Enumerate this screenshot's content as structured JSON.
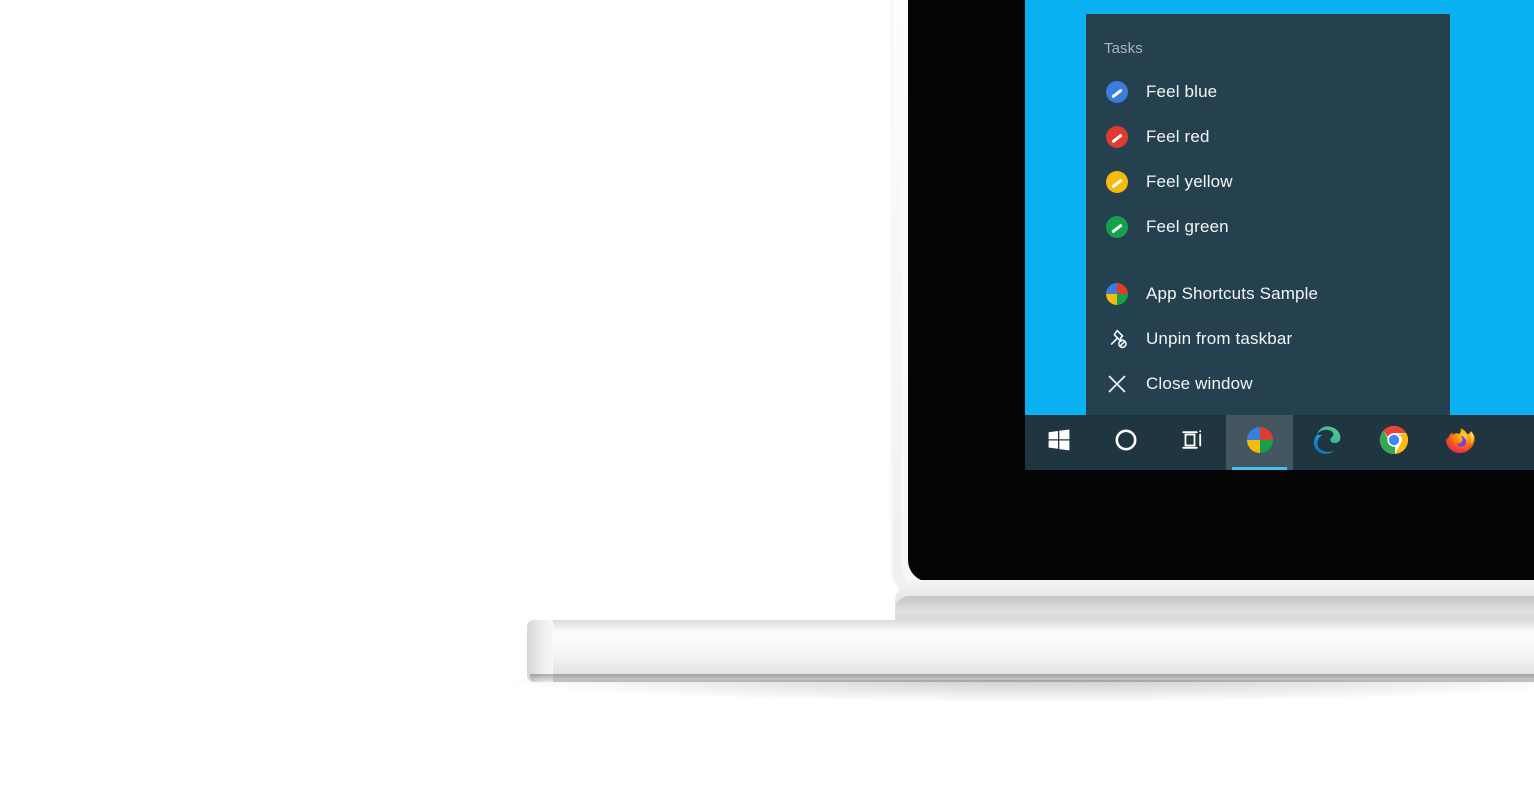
{
  "scene": {
    "device": "laptop",
    "desktop_color": "#09b0f2",
    "taskbar_color": "#1f3540",
    "menu_color": "#25414f"
  },
  "jumplist": {
    "header": "Tasks",
    "tasks": [
      {
        "label": "Feel blue",
        "icon": "pen-circle-blue-icon",
        "color": "#3b7ddd"
      },
      {
        "label": "Feel red",
        "icon": "pen-circle-red-icon",
        "color": "#e03b2f"
      },
      {
        "label": "Feel yellow",
        "icon": "pen-circle-yellow-icon",
        "color": "#f6bc0c"
      },
      {
        "label": "Feel green",
        "icon": "pen-circle-green-icon",
        "color": "#15a04a"
      }
    ],
    "actions": [
      {
        "label": "App Shortcuts Sample",
        "icon": "app-pie-icon"
      },
      {
        "label": "Unpin from taskbar",
        "icon": "unpin-icon"
      },
      {
        "label": "Close window",
        "icon": "close-icon"
      }
    ]
  },
  "taskbar": {
    "items": [
      {
        "name": "start",
        "icon": "windows-logo-icon",
        "active": false
      },
      {
        "name": "cortana",
        "icon": "cortana-circle-icon",
        "active": false
      },
      {
        "name": "task-view",
        "icon": "task-view-icon",
        "active": false
      },
      {
        "name": "app-shortcuts-sample",
        "icon": "app-pie-icon",
        "active": true
      },
      {
        "name": "edge",
        "icon": "edge-icon",
        "active": false
      },
      {
        "name": "chrome",
        "icon": "chrome-icon",
        "active": false
      },
      {
        "name": "firefox",
        "icon": "firefox-icon",
        "active": false
      }
    ],
    "active_indicator_color": "#45bff0"
  }
}
